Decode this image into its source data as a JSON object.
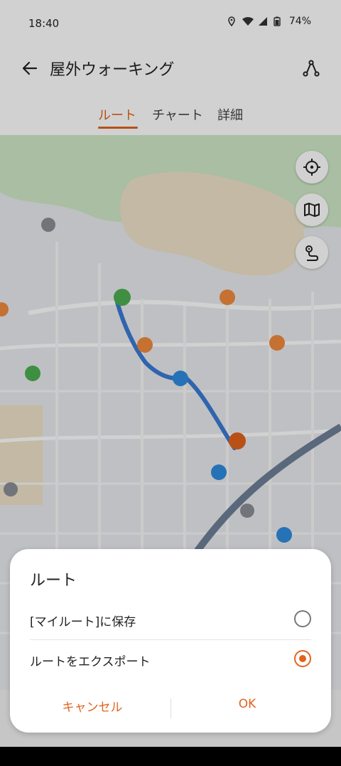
{
  "status_bar": {
    "time": "18:40",
    "battery": "74%",
    "icons": [
      "location-icon",
      "wifi-icon",
      "signal-icon",
      "battery-icon"
    ]
  },
  "app_bar": {
    "title": "屋外ウォーキング",
    "icons": [
      "back-arrow-icon",
      "route-share-icon"
    ]
  },
  "tabs": [
    {
      "label": "ルート",
      "active": true
    },
    {
      "label": "チャート",
      "active": false
    },
    {
      "label": "詳細",
      "active": false
    }
  ],
  "map_controls": [
    "locate-icon",
    "map-layers-icon",
    "route-icon"
  ],
  "dialog": {
    "title": "ルート",
    "options": [
      {
        "label": "[マイルート]に保存",
        "selected": false
      },
      {
        "label": "ルートをエクスポート",
        "selected": true
      }
    ],
    "cancel_label": "キャンセル",
    "ok_label": "OK"
  },
  "colors": {
    "accent": "#e2631c",
    "route": "#3a7bd5",
    "park": "#cfe8c6",
    "land": "#eee2c8"
  }
}
